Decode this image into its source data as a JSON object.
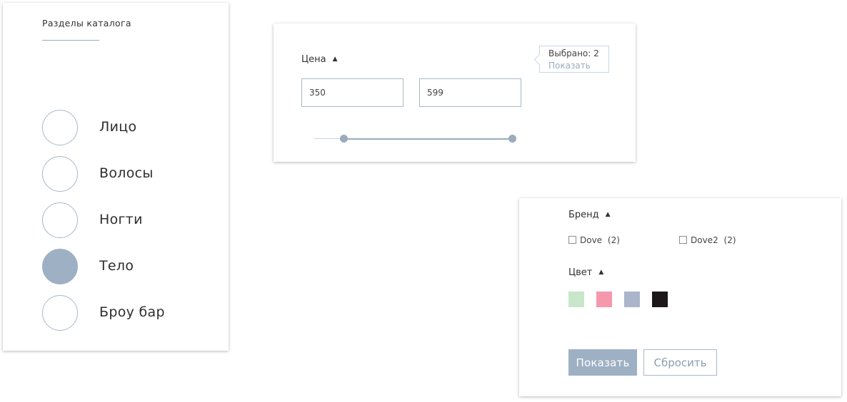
{
  "catalog": {
    "title": "Разделы каталога",
    "items": [
      {
        "label": "Лицо",
        "active": false
      },
      {
        "label": "Волосы",
        "active": false
      },
      {
        "label": "Ногти",
        "active": false
      },
      {
        "label": "Тело",
        "active": true
      },
      {
        "label": "Броу бар",
        "active": false
      }
    ]
  },
  "price": {
    "title": "Цена",
    "min_value": "350",
    "max_value": "599",
    "slider": {
      "low_fraction": 0.15,
      "high_fraction": 1.0
    },
    "tooltip": {
      "count_text": "Выбрано: 2",
      "link_text": "Показать"
    }
  },
  "filters": {
    "brand_title": "Бренд",
    "brands": [
      {
        "label": "Dove",
        "count": "(2)"
      },
      {
        "label": "Dove2",
        "count": "(2)"
      }
    ],
    "color_title": "Цвет",
    "colors": [
      "#c8e6c9",
      "#f598ae",
      "#aab5cb",
      "#1c1819"
    ],
    "show_button": "Показать",
    "reset_button": "Сбросить"
  },
  "icons": {
    "chevron": "chevron-up-icon"
  },
  "accent_color": "#9eb0c4"
}
